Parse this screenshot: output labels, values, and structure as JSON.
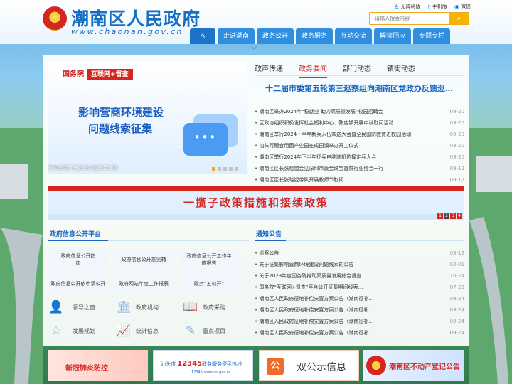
{
  "header": {
    "site_title": "潮南区人民政府",
    "site_url": "www.chaonan.gov.cn",
    "top_links": [
      "无障碍版",
      "手机版",
      "微信"
    ],
    "search_placeholder": "请输入搜索内容",
    "nav": [
      "走进潮南",
      "政务公开",
      "政务服务",
      "互动交流",
      "解读回应",
      "专题专栏"
    ]
  },
  "banner": {
    "tag1": "国务院",
    "tag2": "互联网+督查",
    "title_line1": "影响营商环境建设",
    "title_line2": "问题线索征集",
    "caption": "影响营商环境建设问题线索征集"
  },
  "news": {
    "tabs": [
      "政声传递",
      "政务要闻",
      "部门动态",
      "镇街动态"
    ],
    "active_tab": 1,
    "headline": "十二届市委第五轮第三巡察组向潮南区党政办反馈巡察情况",
    "items": [
      {
        "title": "潮南区举办2024年“稳就业 助力高质量发展”校园招聘会",
        "date": "09-20"
      },
      {
        "title": "区政协组织积极发挥社会福利中心、陈店镇开展中秋慰问活动",
        "date": "09-20"
      },
      {
        "title": "潮南区举行2024下半年新兵入伍欢送大会暨全民国防教育进校园活动",
        "date": "09-20"
      },
      {
        "title": "汕头万雨食用菌产业园在成田镇举办开工仪式",
        "date": "09-20"
      },
      {
        "title": "潮南区举行2024年下半年征兵电脑随机选择定兵大会",
        "date": "09-20"
      },
      {
        "title": "潮南区区长张晓镗会见深圳市黄金珠宝首饰行业协会一行",
        "date": "09-12"
      },
      {
        "title": "潮南区区长张晓镗带队开展教师节慰问",
        "date": "09-12"
      }
    ]
  },
  "strip": {
    "text": "一揽子政策措施和接续政策",
    "pages": [
      "1",
      "2",
      "3",
      "4"
    ]
  },
  "gov_info": {
    "title": "政府信息公开平台",
    "buttons": [
      "政府信息公开指南",
      "政府信息公开意见箱",
      "政府信息公开工作年度报告",
      "政府信息公开依申请公开",
      "政府网站年度工作报表",
      "政务“五公开”"
    ],
    "links": [
      "领导之窗",
      "政府机构",
      "政府采购",
      "发展规划",
      "统计信息",
      "重点项目"
    ]
  },
  "notice": {
    "title": "通知公告",
    "items": [
      {
        "title": "巡察公告",
        "date": "08-12"
      },
      {
        "title": "关于征集影响营商环境建设问题线索的公告",
        "date": "02-01"
      },
      {
        "title": "关于2023年度国务院推动高质量发展综合督查…",
        "date": "10-24"
      },
      {
        "title": "国务院“互联网+督查”平台公开征集期间线索…",
        "date": "07-29"
      },
      {
        "title": "潮南区人民政府征地补偿安置方案公告（潮南征补…",
        "date": "09-24"
      },
      {
        "title": "潮南区人民政府征地补偿安置方案公告（潮南征补…",
        "date": "09-24"
      },
      {
        "title": "潮南区人民政府征地补偿安置方案公告（潮南征补…",
        "date": "09-24"
      },
      {
        "title": "潮南区人民政府征地补偿安置方案公告（潮南征补…",
        "date": "09-24"
      }
    ]
  },
  "ads": {
    "ad1": "新冠肺炎防控",
    "ad2_prefix": "汕头市",
    "ad2_hot": "12345",
    "ad2_suffix": "政务服务便民热线",
    "ad2_sub": "12345.shantou.gov.cn",
    "ad3_badge": "公",
    "ad3": "双公示信息",
    "ad4": "潮南区不动产登记公告"
  },
  "colors": {
    "brand_blue": "#1570c5",
    "nav_blue": "#2f8ee0",
    "accent_red": "#d7261f",
    "search_orange": "#f4b400"
  }
}
